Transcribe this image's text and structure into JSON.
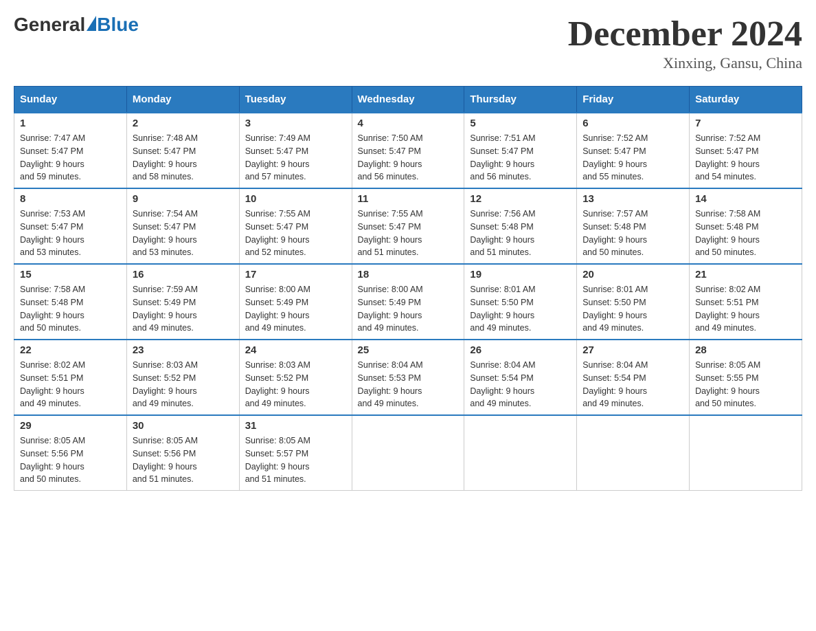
{
  "header": {
    "logo": {
      "general": "General",
      "blue": "Blue"
    },
    "title": "December 2024",
    "location": "Xinxing, Gansu, China"
  },
  "weekdays": [
    "Sunday",
    "Monday",
    "Tuesday",
    "Wednesday",
    "Thursday",
    "Friday",
    "Saturday"
  ],
  "weeks": [
    [
      {
        "day": "1",
        "sunrise": "7:47 AM",
        "sunset": "5:47 PM",
        "daylight": "9 hours and 59 minutes."
      },
      {
        "day": "2",
        "sunrise": "7:48 AM",
        "sunset": "5:47 PM",
        "daylight": "9 hours and 58 minutes."
      },
      {
        "day": "3",
        "sunrise": "7:49 AM",
        "sunset": "5:47 PM",
        "daylight": "9 hours and 57 minutes."
      },
      {
        "day": "4",
        "sunrise": "7:50 AM",
        "sunset": "5:47 PM",
        "daylight": "9 hours and 56 minutes."
      },
      {
        "day": "5",
        "sunrise": "7:51 AM",
        "sunset": "5:47 PM",
        "daylight": "9 hours and 56 minutes."
      },
      {
        "day": "6",
        "sunrise": "7:52 AM",
        "sunset": "5:47 PM",
        "daylight": "9 hours and 55 minutes."
      },
      {
        "day": "7",
        "sunrise": "7:52 AM",
        "sunset": "5:47 PM",
        "daylight": "9 hours and 54 minutes."
      }
    ],
    [
      {
        "day": "8",
        "sunrise": "7:53 AM",
        "sunset": "5:47 PM",
        "daylight": "9 hours and 53 minutes."
      },
      {
        "day": "9",
        "sunrise": "7:54 AM",
        "sunset": "5:47 PM",
        "daylight": "9 hours and 53 minutes."
      },
      {
        "day": "10",
        "sunrise": "7:55 AM",
        "sunset": "5:47 PM",
        "daylight": "9 hours and 52 minutes."
      },
      {
        "day": "11",
        "sunrise": "7:55 AM",
        "sunset": "5:47 PM",
        "daylight": "9 hours and 51 minutes."
      },
      {
        "day": "12",
        "sunrise": "7:56 AM",
        "sunset": "5:48 PM",
        "daylight": "9 hours and 51 minutes."
      },
      {
        "day": "13",
        "sunrise": "7:57 AM",
        "sunset": "5:48 PM",
        "daylight": "9 hours and 50 minutes."
      },
      {
        "day": "14",
        "sunrise": "7:58 AM",
        "sunset": "5:48 PM",
        "daylight": "9 hours and 50 minutes."
      }
    ],
    [
      {
        "day": "15",
        "sunrise": "7:58 AM",
        "sunset": "5:48 PM",
        "daylight": "9 hours and 50 minutes."
      },
      {
        "day": "16",
        "sunrise": "7:59 AM",
        "sunset": "5:49 PM",
        "daylight": "9 hours and 49 minutes."
      },
      {
        "day": "17",
        "sunrise": "8:00 AM",
        "sunset": "5:49 PM",
        "daylight": "9 hours and 49 minutes."
      },
      {
        "day": "18",
        "sunrise": "8:00 AM",
        "sunset": "5:49 PM",
        "daylight": "9 hours and 49 minutes."
      },
      {
        "day": "19",
        "sunrise": "8:01 AM",
        "sunset": "5:50 PM",
        "daylight": "9 hours and 49 minutes."
      },
      {
        "day": "20",
        "sunrise": "8:01 AM",
        "sunset": "5:50 PM",
        "daylight": "9 hours and 49 minutes."
      },
      {
        "day": "21",
        "sunrise": "8:02 AM",
        "sunset": "5:51 PM",
        "daylight": "9 hours and 49 minutes."
      }
    ],
    [
      {
        "day": "22",
        "sunrise": "8:02 AM",
        "sunset": "5:51 PM",
        "daylight": "9 hours and 49 minutes."
      },
      {
        "day": "23",
        "sunrise": "8:03 AM",
        "sunset": "5:52 PM",
        "daylight": "9 hours and 49 minutes."
      },
      {
        "day": "24",
        "sunrise": "8:03 AM",
        "sunset": "5:52 PM",
        "daylight": "9 hours and 49 minutes."
      },
      {
        "day": "25",
        "sunrise": "8:04 AM",
        "sunset": "5:53 PM",
        "daylight": "9 hours and 49 minutes."
      },
      {
        "day": "26",
        "sunrise": "8:04 AM",
        "sunset": "5:54 PM",
        "daylight": "9 hours and 49 minutes."
      },
      {
        "day": "27",
        "sunrise": "8:04 AM",
        "sunset": "5:54 PM",
        "daylight": "9 hours and 49 minutes."
      },
      {
        "day": "28",
        "sunrise": "8:05 AM",
        "sunset": "5:55 PM",
        "daylight": "9 hours and 50 minutes."
      }
    ],
    [
      {
        "day": "29",
        "sunrise": "8:05 AM",
        "sunset": "5:56 PM",
        "daylight": "9 hours and 50 minutes."
      },
      {
        "day": "30",
        "sunrise": "8:05 AM",
        "sunset": "5:56 PM",
        "daylight": "9 hours and 51 minutes."
      },
      {
        "day": "31",
        "sunrise": "8:05 AM",
        "sunset": "5:57 PM",
        "daylight": "9 hours and 51 minutes."
      },
      null,
      null,
      null,
      null
    ]
  ],
  "labels": {
    "sunrise": "Sunrise:",
    "sunset": "Sunset:",
    "daylight": "Daylight:"
  }
}
